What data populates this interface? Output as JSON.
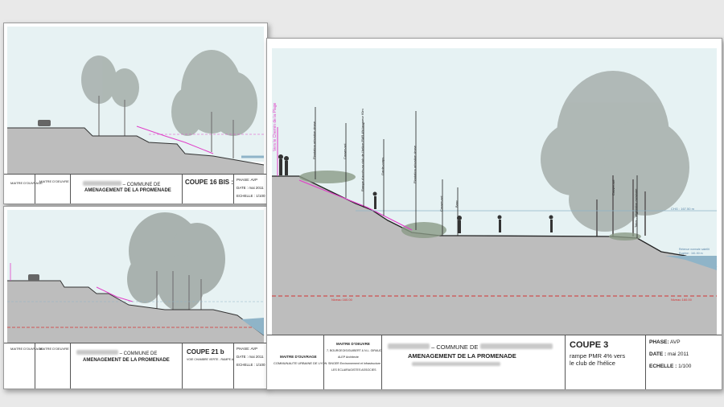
{
  "sheet_main": {
    "phase": "PHASE: AVP",
    "date": "DATE : mai 2011",
    "echelle": "ECHELLE : 1/100",
    "coupe_title": "COUPE 3",
    "coupe_sub1": "rampe PMR 4% vers",
    "coupe_sub2": "le club de l'hélice",
    "commune": "– COMMUNE DE",
    "amenagement": "AMENAGEMENT DE LA PROMENADE",
    "maitre_ouvrage": "MAITRE D'OUVRAGE",
    "communaute": "COMMUNAUTE URBAINE DE LYON",
    "maitre_oeuvre": "MAITRE D'OEUVRE",
    "moe_l1": "7, BOURGEOIS/GUIBERT & N.L. GIRAUD",
    "moe_l2": "ALEP Architecte",
    "moe_l3": "SINGER Environnement et Infrastructure",
    "moe_l4": "LES ECLAIRAGISTES ASSOCIES",
    "level_left": "Niveau 160.00",
    "level_right": "Niveau 160.00",
    "water_label": "CHG : 167.50 m",
    "water_label2": "Retenue normale satellit",
    "water_label3": "Eugène : 161.50 m",
    "annotations": [
      "Vers le Chemin de la Plage",
      "Plantation arbustive dense",
      "Couvre-sol",
      "Rampe d'accès au club de l'hélice PMR 4% longueur 60m",
      "Garde-corps",
      "Plantation arbustive dense",
      "Couvre-sol",
      "Banc",
      "Couvre-sol",
      "Talus - végétation existante"
    ]
  },
  "sheet_top": {
    "coupe_title": "COUPE 16 BIS :",
    "commune": "– COMMUNE DE",
    "amenagement": "AMENAGEMENT DE LA PROMENADE",
    "phase": "PHASE: AVP",
    "date": "DATE : mai 2011",
    "echelle": "ECHELLE : 1/100",
    "maitre_ouvrage": "MAITRE D'OUVRAGE",
    "maitre_oeuvre": "MAITRE D'OEUVRE"
  },
  "sheet_bottom": {
    "coupe_title": "COUPE 21 b",
    "coupe_sub": "VOIE CHAMBRE VERTE - RAMPE A",
    "commune": "– COMMUNE DE",
    "amenagement": "AMENAGEMENT DE LA PROMENADE",
    "phase": "PHASE: AVP",
    "date": "DATE : mai 2011",
    "echelle": "ECHELLE : 1/100",
    "maitre_ouvrage": "MAITRE D'OUVRAGE",
    "maitre_oeuvre": "MAITRE D'OEUVRE"
  },
  "colors": {
    "ground": "#bdbdbd",
    "sky": "#e6f2f3",
    "water": "#8fb4c8",
    "ramp": "#e040c8",
    "datum": "#d33333",
    "tree": "#9ca6a2"
  }
}
